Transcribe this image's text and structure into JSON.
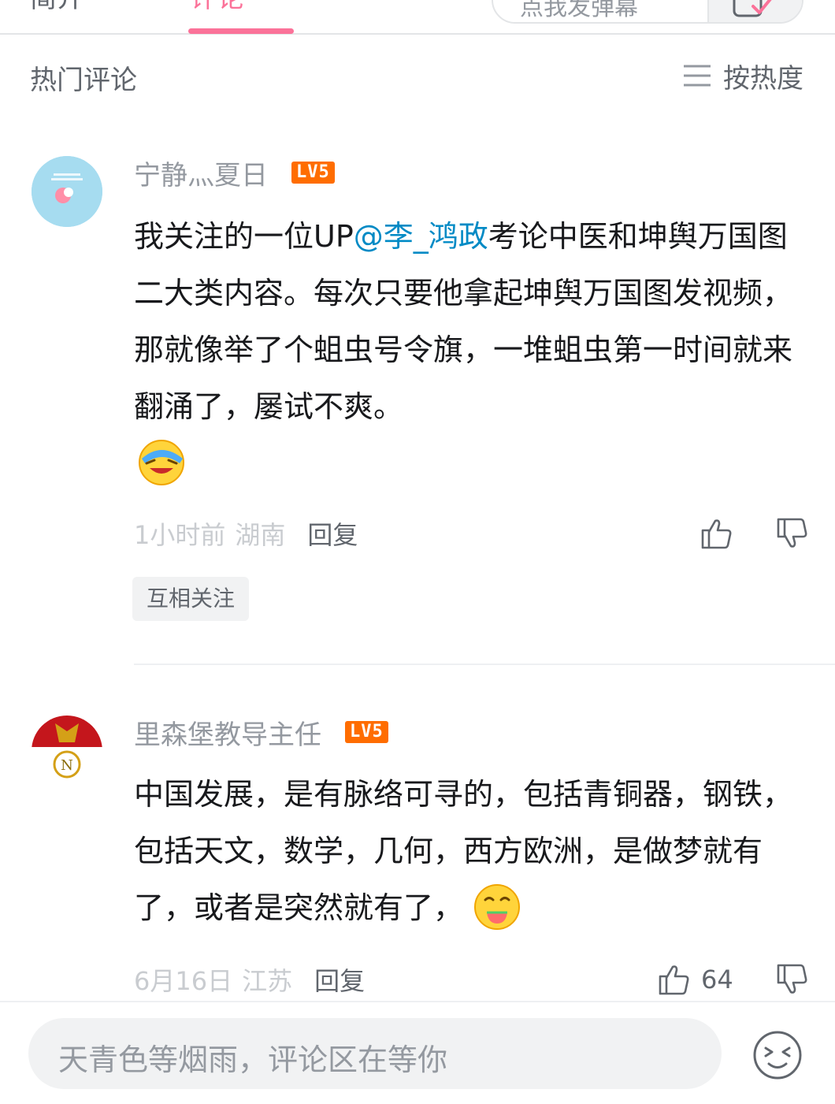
{
  "tabs": {
    "intro": "简介",
    "comments": "评论"
  },
  "danmaku": {
    "placeholder": "点我发弹幕"
  },
  "section": {
    "title": "热门评论",
    "sort_label": "按热度"
  },
  "comments": [
    {
      "username": "宁静灬夏日",
      "level": "LV5",
      "content_before": "我关注的一位UP",
      "mention": "@李_鸿政",
      "content_after": "考论中医和坤舆万国图二大类内容。每次只要他拿起坤舆万国图发视频，那就像举了个蛆虫号令旗，一堆蛆虫第一时间就来翻涌了，屡试不爽。",
      "emoji": "face-palm-laugh-emoji",
      "time": "1小时前",
      "location": "湖南",
      "reply_label": "回复",
      "likes": "",
      "tag": "互相关注"
    },
    {
      "username": "里森堡教导主任",
      "level": "LV5",
      "content": "中国发展，是有脉络可寻的，包括青铜器，钢铁，包括天文，数学，几何，西方欧洲，是做梦就有了，或者是突然就有了，",
      "emoji": "eating-watermelon-emoji",
      "time": "6月16日",
      "location": "江苏",
      "reply_label": "回复",
      "likes": "64"
    }
  ],
  "bottom": {
    "input_placeholder": "天青色等烟雨，评论区在等你"
  },
  "colors": {
    "accent": "#fb7299",
    "level_badge": "#ff6d00",
    "mention": "#008ac5"
  },
  "icons": [
    "sort-lines-icon",
    "thumb-up-icon",
    "thumb-down-icon",
    "emoji-face-icon",
    "danmaku-settings-icon"
  ]
}
